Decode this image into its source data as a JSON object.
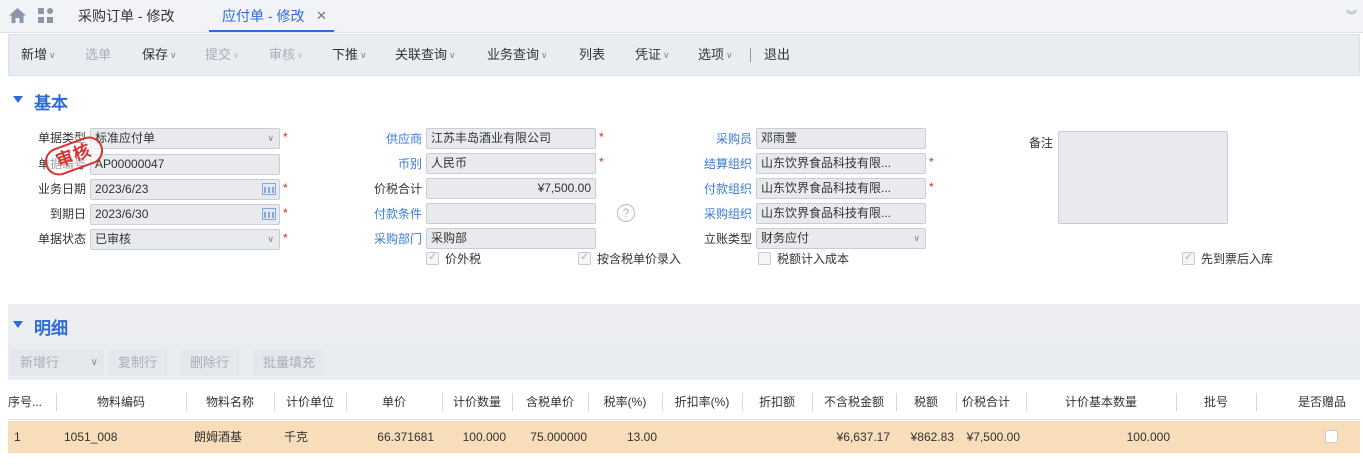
{
  "tabs": {
    "tab1": "采购订单 - 修改",
    "tab2": "应付单 - 修改"
  },
  "toolbar": {
    "new": "新增",
    "select": "选单",
    "save": "保存",
    "submit": "提交",
    "audit": "审核",
    "push": "下推",
    "related_query": "关联查询",
    "business_query": "业务查询",
    "list": "列表",
    "voucher": "凭证",
    "options": "选项",
    "exit": "退出"
  },
  "sections": {
    "basic": "基本",
    "detail": "明细"
  },
  "stamp": "审核",
  "form": {
    "bill_type_label": "单据类型",
    "bill_type_value": "标准应付单",
    "bill_no_label": "单据编号",
    "bill_no_value": "AP00000047",
    "biz_date_label": "业务日期",
    "biz_date_value": "2023/6/23",
    "due_date_label": "到期日",
    "due_date_value": "2023/6/30",
    "status_label": "单据状态",
    "status_value": "已审核",
    "supplier_label": "供应商",
    "supplier_value": "江苏丰岛酒业有限公司",
    "currency_label": "币别",
    "currency_value": "人民币",
    "total_label": "价税合计",
    "total_value": "¥7,500.00",
    "payterm_label": "付款条件",
    "payterm_value": "",
    "purdept_label": "采购部门",
    "purdept_value": "采购部",
    "tax_excluded_label": "价外税",
    "input_by_tax_price_label": "按含税单价录入",
    "buyer_label": "采购员",
    "buyer_value": "邓雨萱",
    "settle_org_label": "结算组织",
    "settle_org_value": "山东饮界食品科技有限...",
    "pay_org_label": "付款组织",
    "pay_org_value": "山东饮界食品科技有限...",
    "pur_org_label": "采购组织",
    "pur_org_value": "山东饮界食品科技有限...",
    "account_type_label": "立账类型",
    "account_type_value": "财务应付",
    "tax_in_cost_label": "税额计入成本",
    "remark_label": "备注",
    "invoice_first_label": "先到票后入库"
  },
  "detail_toolbar": {
    "add_row": "新增行",
    "copy_row": "复制行",
    "delete_row": "删除行",
    "batch_fill": "批量填充"
  },
  "table": {
    "headers": [
      "序号...",
      "物料编码",
      "物料名称",
      "计价单位",
      "单价",
      "计价数量",
      "含税单价",
      "税率(%)",
      "折扣率(%)",
      "折扣额",
      "不含税金额",
      "税额",
      "价税合计",
      "计价基本数量",
      "批号",
      "是否赠品"
    ],
    "rows": [
      [
        "1",
        "1051_008",
        "朗姆酒基",
        "千克",
        "66.371681",
        "100.000",
        "75.000000",
        "13.00",
        "",
        "",
        "¥6,637.17",
        "¥862.83",
        "¥7,500.00",
        "100.000",
        "",
        ""
      ]
    ]
  },
  "colors": {
    "accent": "#2f6bd6",
    "link": "#3b7bd6",
    "required": "#e0281c",
    "selected_row": "#f7ddb9",
    "stamp": "#d93030"
  }
}
